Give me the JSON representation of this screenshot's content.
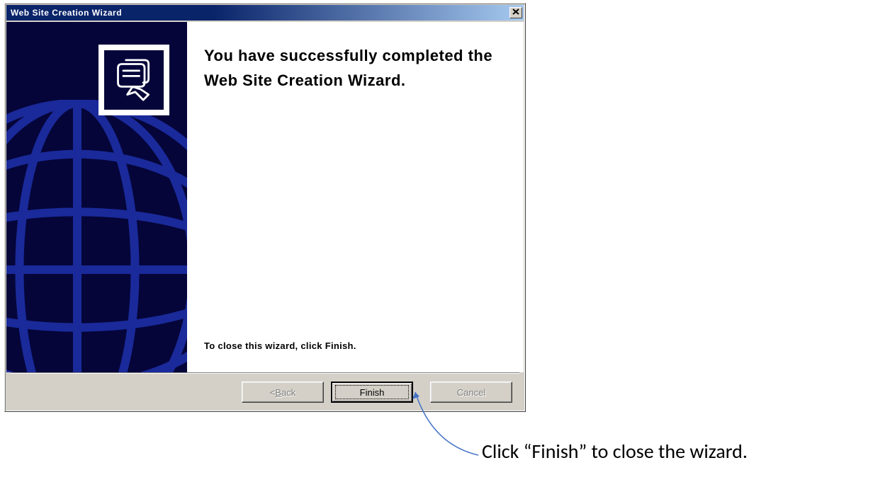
{
  "window": {
    "title": "Web Site Creation Wizard",
    "close_label": "✕"
  },
  "content": {
    "heading": "You have successfully completed the Web Site Creation Wizard.",
    "instruction": "To close this wizard, click Finish."
  },
  "buttons": {
    "back": {
      "prefix": "< ",
      "u": "B",
      "rest": "ack"
    },
    "finish": "Finish",
    "cancel": "Cancel"
  },
  "callout": {
    "text": "Click “Finish” to close the wizard."
  }
}
